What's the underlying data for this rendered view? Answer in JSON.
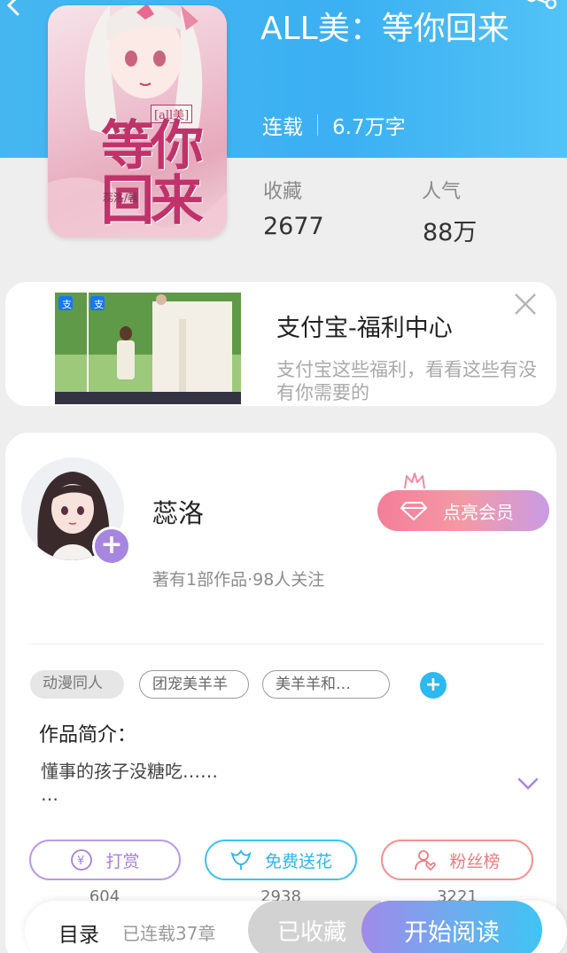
{
  "book": {
    "title": "ALL美：等你回来",
    "status": "连载",
    "word_count": "6.7万字",
    "stats": [
      {
        "label": "收藏",
        "value": "2677"
      },
      {
        "label": "人气",
        "value": "88万"
      }
    ],
    "cover": {
      "tag": "[all美]",
      "title": "等你回来",
      "author": "蕊洛/著"
    }
  },
  "ad": {
    "title": "支付宝-福利中心",
    "description": "支付宝这些福利，看看这些有没有你需要的"
  },
  "author": {
    "name": "蕊洛",
    "meta": "著有1部作品·98人关注",
    "vip_label": "点亮会员"
  },
  "tags": [
    "动漫同人",
    "团宠美羊羊",
    "美羊羊和…"
  ],
  "intro": {
    "label": "作品简介：",
    "text": "懂事的孩子没糖吃……\n…"
  },
  "actions": [
    {
      "label": "打赏",
      "count": "604",
      "color": "#b17fe0"
    },
    {
      "label": "免费送花",
      "count": "2938",
      "color": "#30bdf0"
    },
    {
      "label": "粉丝榜",
      "count": "3221",
      "color": "#f07a8a"
    }
  ],
  "bottom_bar": {
    "toc_label": "目录",
    "toc_meta": "已连载37章",
    "favorite_label": "已收藏",
    "read_label": "开始阅读"
  },
  "icons": {
    "back": "back-arrow-icon",
    "share": "share-icon",
    "close": "close-icon",
    "plus": "plus-icon",
    "diamond": "diamond-icon",
    "crown": "crown-icon",
    "expand": "chevron-down-icon",
    "yen": "yen-coin-icon",
    "flower": "flower-icon",
    "fans": "user-heart-icon"
  },
  "colors": {
    "header": "#45b6f0",
    "accent_blue": "#2db8ef",
    "accent_purple": "#a786e0"
  }
}
